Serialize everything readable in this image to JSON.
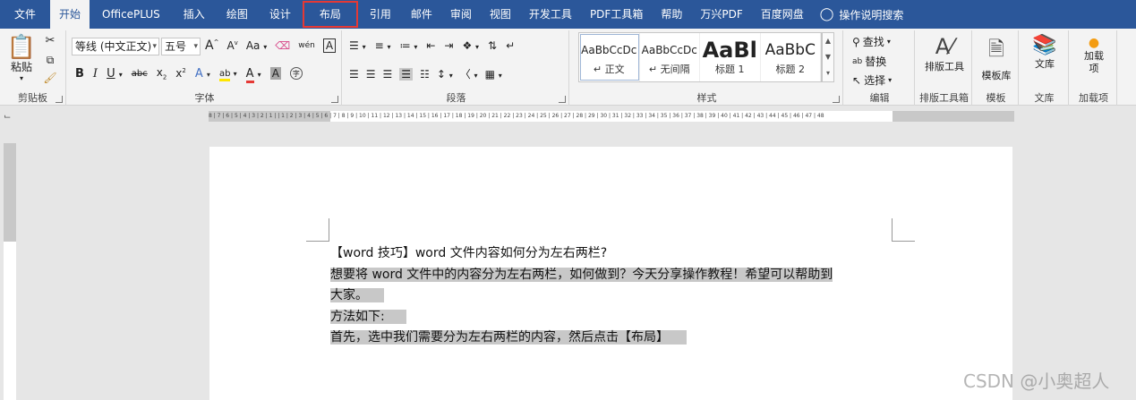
{
  "menu": {
    "tabs": [
      "文件",
      "开始",
      "OfficePLUS",
      "插入",
      "绘图",
      "设计",
      "布局",
      "引用",
      "邮件",
      "审阅",
      "视图",
      "开发工具",
      "PDF工具箱",
      "帮助",
      "万兴PDF",
      "百度网盘"
    ],
    "active": "开始",
    "highlighted": "布局",
    "help_search": "操作说明搜索"
  },
  "clipboard": {
    "paste": "粘贴",
    "label": "剪贴板"
  },
  "font": {
    "font_name": "等线 (中文正文)",
    "font_size": "五号",
    "grow": "A",
    "shrink": "A",
    "change_case": "Aa",
    "clear_format": "⌫",
    "phonetic": "wén",
    "border_char": "A",
    "bold": "B",
    "italic": "I",
    "underline": "U",
    "strike": "abc",
    "subscript": "x",
    "superscript": "x",
    "text_effect": "A",
    "highlight": "ab",
    "font_color": "A",
    "char_shading": "A",
    "enclose": "字",
    "label": "字体"
  },
  "paragraph": {
    "label": "段落"
  },
  "styles": {
    "items": [
      {
        "preview": "AaBbCcDc",
        "name": "↵ 正文"
      },
      {
        "preview": "AaBbCcDc",
        "name": "↵ 无间隔"
      },
      {
        "preview": "AaBl",
        "name": "标题 1"
      },
      {
        "preview": "AaBbC",
        "name": "标题 2"
      }
    ],
    "label": "样式"
  },
  "editing": {
    "find": "查找",
    "replace": "替换",
    "select": "选择",
    "label": "编辑"
  },
  "typeset": {
    "button": "排版工具",
    "label": "排版工具箱"
  },
  "templates": {
    "button": "模板库",
    "label": "模板"
  },
  "library": {
    "button": "文库",
    "label": "文库"
  },
  "addins": {
    "button": "加载项",
    "label": "加载项"
  },
  "ruler": {
    "numbers": "8 | 7 | 6 | 5 | 4 | 3 | 2 | 1 |   | 1 | 2 | 3 | 4 | 5 | 6 | 7 | 8 | 9 | 10 | 11 | 12 | 13 | 14 | 15 | 16 | 17 | 18 | 19 | 20 | 21 | 22 | 23 | 24 | 25 | 26 | 27 | 28 | 29 | 30 | 31 | 32 | 33 | 34 | 35 | 36 | 37 | 38 | 39 | 40 | 41 | 42 | 43 | 44 | 45 | 46 | 47 | 48"
  },
  "document": {
    "title_line": "【word 技巧】word 文件内容如何分为左右两栏?",
    "p1a": "想要将 word 文件中的内容分为左右两栏，如何做到？今天分享操作教程！希望可以帮助到",
    "p1b": "大家。",
    "p2": "方法如下:",
    "p3": "首先，选中我们需要分为左右两栏的内容，然后点击【布局】"
  },
  "watermark": "CSDN @小奥超人"
}
